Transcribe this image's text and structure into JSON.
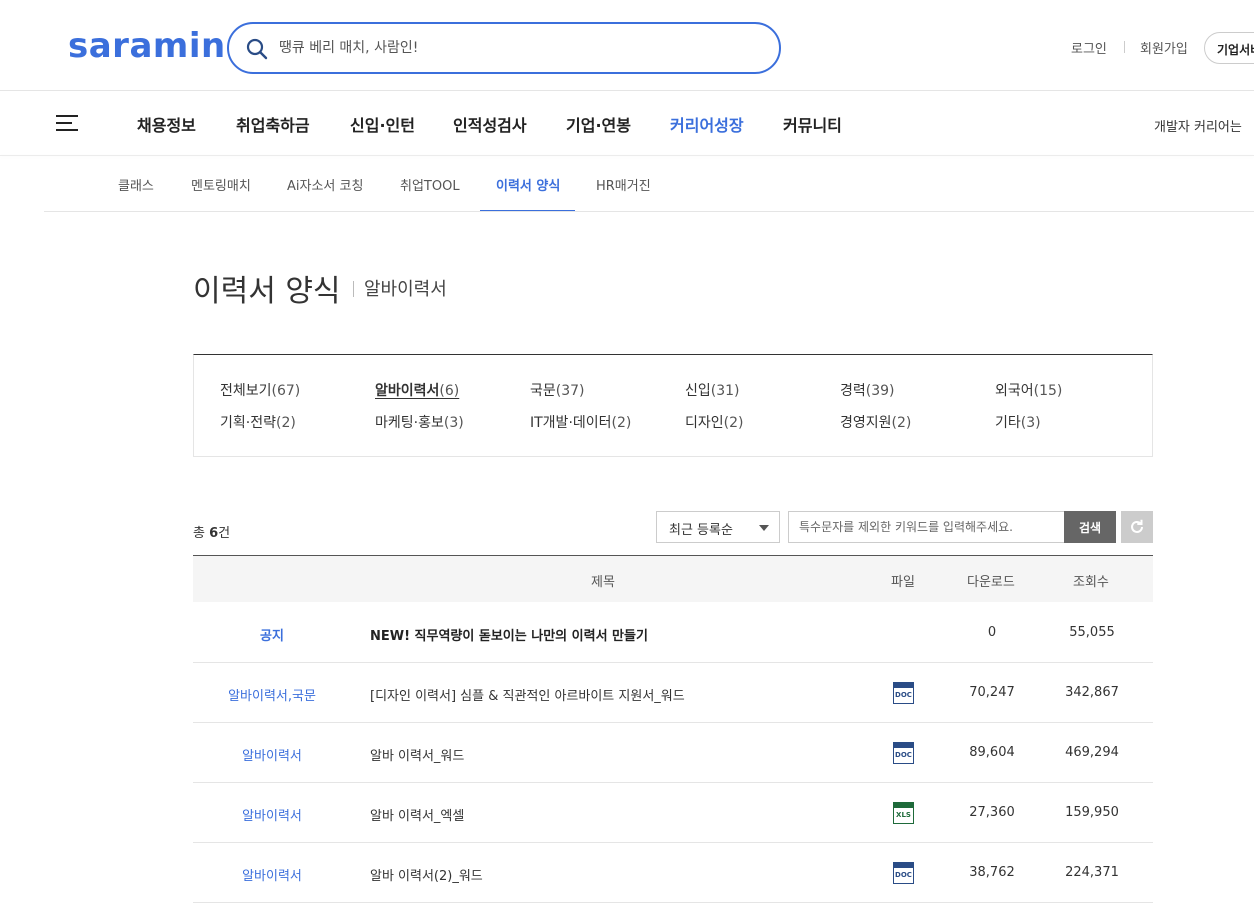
{
  "header": {
    "logo_text": "saramin",
    "search_placeholder": "땡큐 베리 매치, 사람인!",
    "login": "로그인",
    "signup": "회원가입",
    "corp_service": "기업서비스"
  },
  "nav": {
    "items": [
      "채용정보",
      "취업축하금",
      "신입·인턴",
      "인적성검사",
      "기업·연봉",
      "커리어성장",
      "커뮤니티"
    ],
    "active_index": 5,
    "dev_community": "개발자 커리어는"
  },
  "subnav": {
    "items": [
      "클래스",
      "멘토링매치",
      "Ai자소서 코칭",
      "취업TOOL",
      "이력서 양식",
      "HR매거진"
    ],
    "active_index": 4
  },
  "page": {
    "title": "이력서 양식",
    "subtitle": "알바이력서"
  },
  "categories": [
    {
      "label": "전체보기",
      "count": "(67)"
    },
    {
      "label": "알바이력서",
      "count": "(6)"
    },
    {
      "label": "국문",
      "count": "(37)"
    },
    {
      "label": "신입",
      "count": "(31)"
    },
    {
      "label": "경력",
      "count": "(39)"
    },
    {
      "label": "외국어",
      "count": "(15)"
    },
    {
      "label": "기획·전략",
      "count": "(2)"
    },
    {
      "label": "마케팅·홍보",
      "count": "(3)"
    },
    {
      "label": "IT개발·데이터",
      "count": "(2)"
    },
    {
      "label": "디자인",
      "count": "(2)"
    },
    {
      "label": "경영지원",
      "count": "(2)"
    },
    {
      "label": "기타",
      "count": "(3)"
    }
  ],
  "list": {
    "total_prefix": "총",
    "total_count": "6",
    "total_suffix": "건",
    "sort_selected": "최근 등록순",
    "keyword_placeholder": "특수문자를 제외한 키워드를 입력해주세요.",
    "search_button": "검색"
  },
  "table": {
    "headers": {
      "title": "제목",
      "file": "파일",
      "downloads": "다운로드",
      "views": "조회수"
    },
    "rows": [
      {
        "category": "공지",
        "title": "NEW! 직무역량이 돋보이는 나만의 이력서 만들기",
        "file": "",
        "downloads": "0",
        "views": "55,055"
      },
      {
        "category": "알바이력서,국문",
        "title": "[디자인 이력서] 심플 & 직관적인 아르바이트 지원서_워드",
        "file": "DOC",
        "downloads": "70,247",
        "views": "342,867"
      },
      {
        "category": "알바이력서",
        "title": "알바 이력서_워드",
        "file": "DOC",
        "downloads": "89,604",
        "views": "469,294"
      },
      {
        "category": "알바이력서",
        "title": "알바 이력서_엑셀",
        "file": "XLS",
        "downloads": "27,360",
        "views": "159,950"
      },
      {
        "category": "알바이력서",
        "title": "알바 이력서(2)_워드",
        "file": "DOC",
        "downloads": "38,762",
        "views": "224,371"
      }
    ]
  },
  "colors": {
    "brand": "#3b6fdc",
    "logo_dot": "#ff7a00",
    "doc_icon": "#2a4c86",
    "xls_icon": "#1e6a3a"
  },
  "icons": {
    "search": "search-icon",
    "menu": "hamburger-icon",
    "reset": "refresh-icon",
    "dropdown": "chevron-down-icon"
  }
}
